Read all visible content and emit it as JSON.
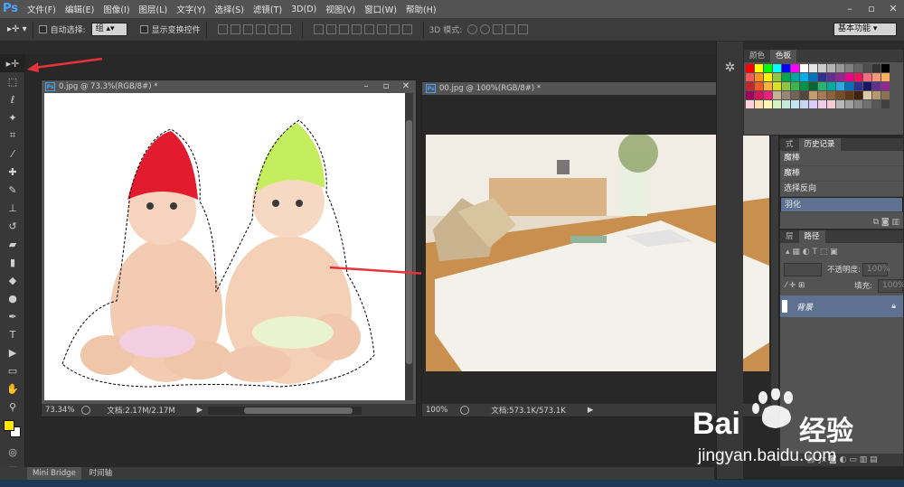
{
  "app": {
    "logo": "Ps"
  },
  "menu": [
    "文件(F)",
    "编辑(E)",
    "图像(I)",
    "图层(L)",
    "文字(Y)",
    "选择(S)",
    "滤镜(T)",
    "3D(D)",
    "视图(V)",
    "窗口(W)",
    "帮助(H)"
  ],
  "options": {
    "auto_select_label": "自动选择:",
    "auto_select_value": "组",
    "show_transform_label": "显示变换控件",
    "mode3d_label": "3D 模式:",
    "workspace": "基本功能"
  },
  "doc1": {
    "title": "0.jpg @ 73.3%(RGB/8#) *",
    "zoom": "73.34%",
    "docinfo": "文档:2.17M/2.17M"
  },
  "doc2": {
    "title": "00.jpg @ 100%(RGB/8#) *",
    "zoom": "100%",
    "docinfo": "文档:573.1K/573.1K"
  },
  "swatches_panel": {
    "tabs": [
      "颜色",
      "色板"
    ]
  },
  "history_panel": {
    "tabs": [
      "式",
      "历史记录"
    ],
    "items": [
      "魔棒",
      "魔棒",
      "选择反向",
      "羽化"
    ]
  },
  "layers_panel": {
    "tabs": [
      "层",
      "路径"
    ],
    "opacity_label": "不透明度:",
    "opacity_value": "100%",
    "fill_label": "填充:",
    "fill_value": "100%",
    "layer_name": "背景"
  },
  "bottom": {
    "tabs": [
      "Mini Bridge",
      "时间轴"
    ]
  },
  "watermark": {
    "brand_left": "Bai",
    "brand_right": "经验",
    "url": "jingyan.baidu.com"
  },
  "colors": {
    "foreground": "#ffe600",
    "background": "#ffffff",
    "accent": "#4aa3ff",
    "arrow": "#e8333a"
  }
}
